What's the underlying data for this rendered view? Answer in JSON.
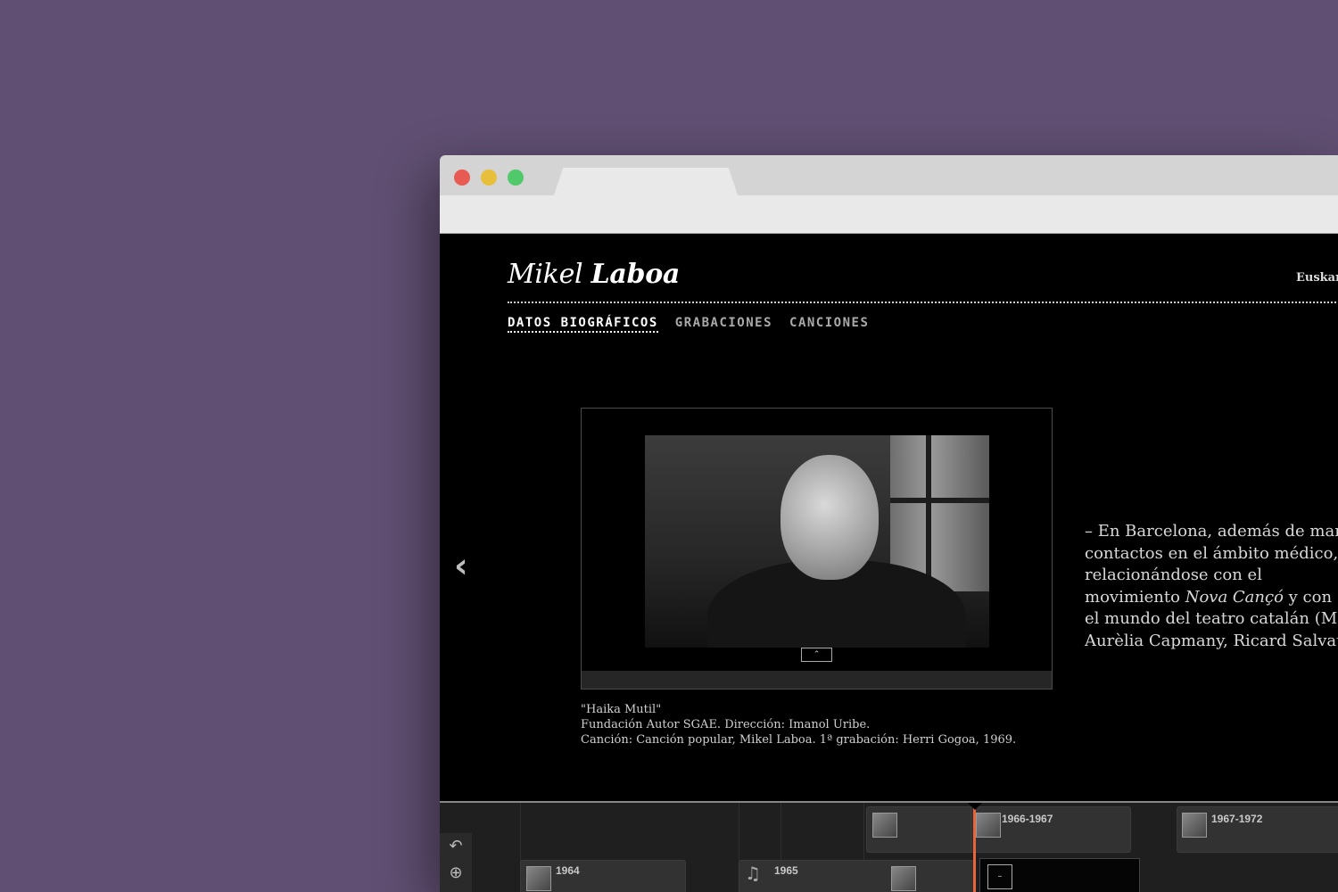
{
  "site": {
    "logo_first": "Mikel",
    "logo_last": "Laboa",
    "language": "Euskara"
  },
  "nav": {
    "items": [
      {
        "label": "DATOS BIOGRÁFICOS",
        "active": true
      },
      {
        "label": "GRABACIONES",
        "active": false
      },
      {
        "label": "CANCIONES",
        "active": false
      }
    ]
  },
  "video": {
    "expand_icon": "chevron-up-icon",
    "expand_glyph": "⌃"
  },
  "caption": {
    "line1": "\"Haika Mutil\"",
    "line2": "Fundación Autor SGAE. Dirección: Imanol Uribe.",
    "line3": "Canción: Canción popular, Mikel Laboa. 1ª grabación: Herri Gogoa, 1969."
  },
  "bio": {
    "line1": "– En Barcelona, además de mantener",
    "line2": "contactos en el ámbito médico, sigue",
    "line3": "relacionándose con el",
    "line4_a": "movimiento ",
    "line4_em": "Nova Cançó",
    "line4_b": " y con",
    "line5": "el mundo del teatro catalán (Maria",
    "line6": "Aurèlia Capmany, Ricard Salvat, etc."
  },
  "navigation": {
    "prev_glyph": "‹"
  },
  "timeline": {
    "tools": {
      "back_glyph": "↶",
      "zoom_glyph": "⊕"
    },
    "labels": {
      "y1964": "1964",
      "y1965": "1965",
      "y1966_1967": "1966-1967",
      "y1967_1972": "1967-1972"
    },
    "note_glyph": "♫",
    "dark_box_glyph": "–"
  },
  "colors": {
    "background": "#604f72",
    "playhead": "#e8643a"
  }
}
